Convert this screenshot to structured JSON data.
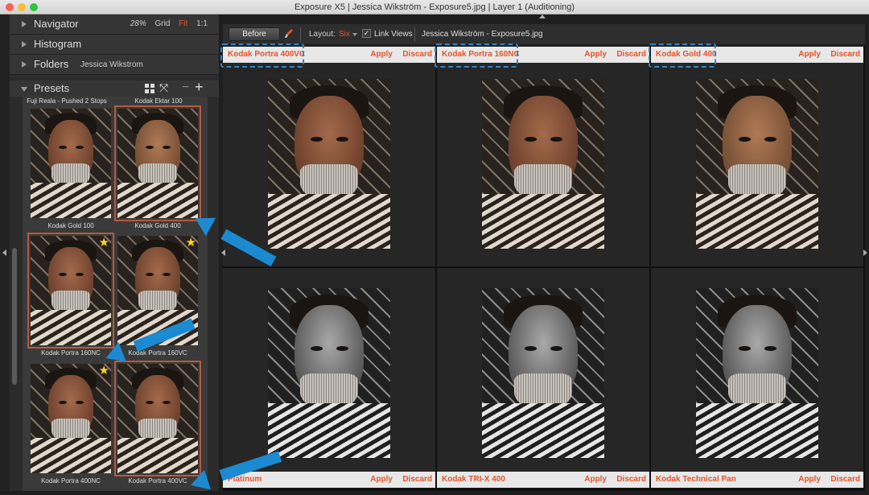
{
  "window": {
    "title": "Exposure X5 | Jessica Wikström - Exposure5.jpg | Layer 1 (Auditioning)"
  },
  "panels": {
    "navigator": {
      "label": "Navigator",
      "zoom": "28%",
      "grid": "Grid",
      "fit": "Fit",
      "one_to_one": "1:1"
    },
    "histogram": {
      "label": "Histogram"
    },
    "folders": {
      "label": "Folders",
      "current": "Jessica Wikstrom"
    },
    "presets": {
      "label": "Presets"
    }
  },
  "presets": {
    "top_labels": [
      "Fuji Reala - Pushed 2 Stops",
      "Kodak Ektar 100"
    ],
    "items": [
      {
        "label": "Kodak Gold 100",
        "starred": false,
        "selected": false,
        "tone": "color"
      },
      {
        "label": "Kodak Gold 400",
        "starred": false,
        "selected": true,
        "tone": "gold"
      },
      {
        "label": "Kodak Portra 160NC",
        "starred": true,
        "selected": true,
        "tone": "color"
      },
      {
        "label": "Kodak Portra 160VC",
        "starred": true,
        "selected": false,
        "tone": "color"
      },
      {
        "label": "Kodak Portra 400NC",
        "starred": true,
        "selected": false,
        "tone": "color"
      },
      {
        "label": "Kodak Portra 400VC",
        "starred": false,
        "selected": true,
        "tone": "color"
      }
    ],
    "star_glyph": "★"
  },
  "toolbar": {
    "before_label": "Before",
    "layout_label": "Layout:",
    "layout_value": "Six",
    "link_views_label": "Link Views",
    "link_views_checked": "✓",
    "filename": "Jessica Wikström - Exposure5.jpg"
  },
  "audition": {
    "apply_label": "Apply",
    "discard_label": "Discard",
    "panes": [
      {
        "name": "Kodak Portra 400VC",
        "tone": "color",
        "bar": "top",
        "highlight": true
      },
      {
        "name": "Kodak Portra 160NC",
        "tone": "color",
        "bar": "top",
        "highlight": true
      },
      {
        "name": "Kodak Gold 400",
        "tone": "gold",
        "bar": "top",
        "highlight": true
      },
      {
        "name": "Platinum",
        "tone": "bw",
        "bar": "bottom",
        "highlight": false
      },
      {
        "name": "Kodak TRI-X 400",
        "tone": "bw",
        "bar": "bottom",
        "highlight": false
      },
      {
        "name": "Kodak Technical Pan",
        "tone": "bw",
        "bar": "bottom",
        "highlight": false
      }
    ]
  },
  "colors": {
    "accent": "#e2542a",
    "callout": "#1b8ad0",
    "selection": "#b9583b",
    "star": "#ffd21f"
  }
}
